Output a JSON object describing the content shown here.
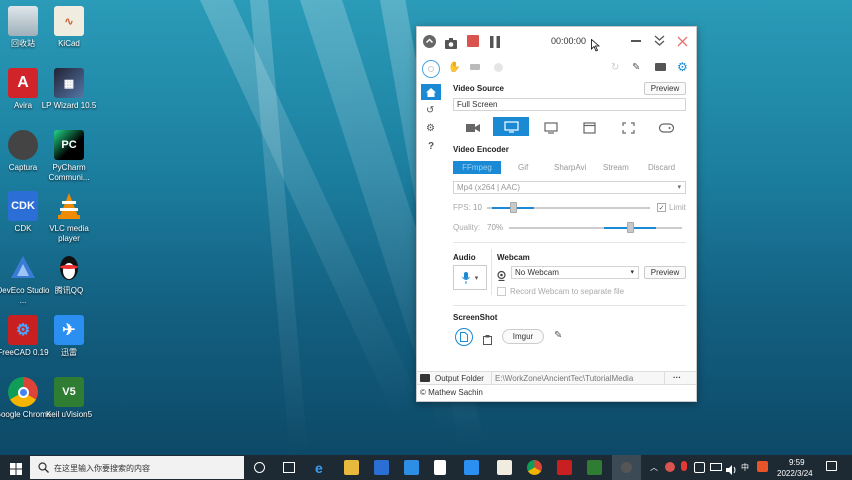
{
  "desktop": {
    "icons": [
      {
        "label": "回收站"
      },
      {
        "label": "KiCad"
      },
      {
        "label": "Avira"
      },
      {
        "label": "LP Wizard 10.5"
      },
      {
        "label": "Captura"
      },
      {
        "label": "PyCharm Communi..."
      },
      {
        "label": "CDK"
      },
      {
        "label": "VLC media player"
      },
      {
        "label": "DevEco Studio ..."
      },
      {
        "label": "腾讯QQ"
      },
      {
        "label": "FreeCAD 0.19"
      },
      {
        "label": "迅雷"
      },
      {
        "label": "Google Chrome"
      },
      {
        "label": "Keil uVision5"
      }
    ]
  },
  "app": {
    "timer": "00:00:00",
    "video_source": {
      "title": "Video Source",
      "preview": "Preview",
      "value": "Full Screen"
    },
    "video_encoder": {
      "title": "Video Encoder",
      "tabs": [
        "FFmpeg",
        "Gif",
        "SharpAvi",
        "Stream",
        "Discard"
      ],
      "codec": "Mp4 (x264 | AAC)",
      "fps_label": "FPS:",
      "fps_value": "10",
      "limit_label": "Limit",
      "quality_label": "Quality:",
      "quality_value": "70%",
      "fps_level": 0.16,
      "quality_level": 0.7
    },
    "audio": {
      "title": "Audio"
    },
    "webcam": {
      "title": "Webcam",
      "value": "No Webcam",
      "preview": "Preview",
      "record_separate": "Record Webcam to separate file"
    },
    "screenshot": {
      "title": "ScreenShot",
      "imgur": "Imgur"
    },
    "output": {
      "label": "Output Folder",
      "path": "E:\\WorkZone\\AncientTec\\TutorialMedia",
      "more": "···"
    },
    "author": "© Mathew Sachin"
  },
  "taskbar": {
    "search_placeholder": "在这里输入你要搜索的内容",
    "ime": "中",
    "time": "9:59",
    "date": "2022/3/24"
  },
  "colors": {
    "accent": "#1a8ad4",
    "record": "#d9534f"
  }
}
